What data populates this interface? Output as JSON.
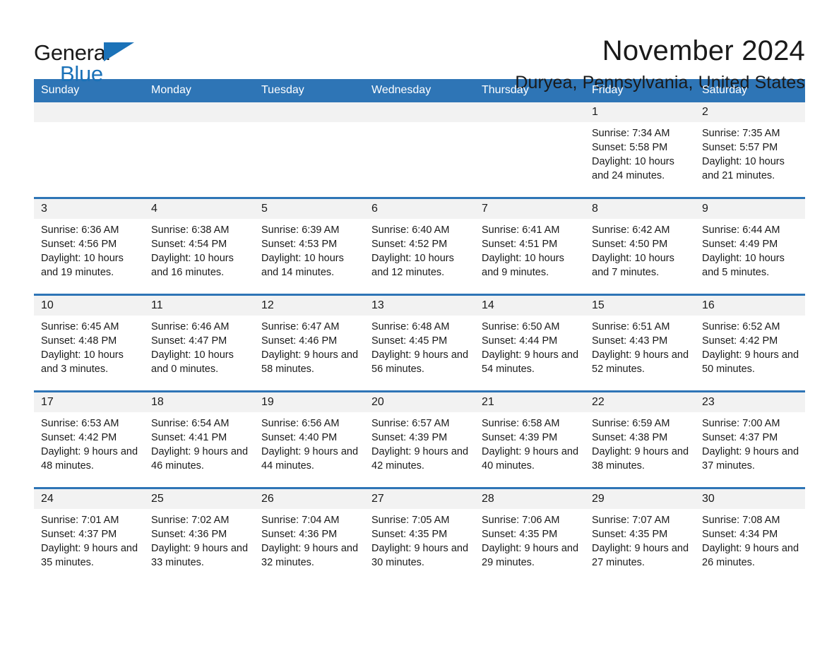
{
  "brand": {
    "name_part1": "General",
    "name_part2": "Blue",
    "accent_color": "#1b72b8",
    "flag_icon": "blue-triangle-icon"
  },
  "header": {
    "title": "November 2024",
    "subtitle": "Duryea, Pennsylvania, United States"
  },
  "theme": {
    "header_blue": "#2e75b6",
    "daynum_band": "#f2f2f2",
    "page_background": "#ffffff",
    "text": "#1a1a1a"
  },
  "calendar": {
    "weekday_headers": [
      "Sunday",
      "Monday",
      "Tuesday",
      "Wednesday",
      "Thursday",
      "Friday",
      "Saturday"
    ],
    "labels": {
      "sunrise": "Sunrise:",
      "sunset": "Sunset:",
      "daylight": "Daylight:"
    },
    "weeks": [
      [
        {
          "day": "",
          "sunrise": "",
          "sunset": "",
          "daylight": ""
        },
        {
          "day": "",
          "sunrise": "",
          "sunset": "",
          "daylight": ""
        },
        {
          "day": "",
          "sunrise": "",
          "sunset": "",
          "daylight": ""
        },
        {
          "day": "",
          "sunrise": "",
          "sunset": "",
          "daylight": ""
        },
        {
          "day": "",
          "sunrise": "",
          "sunset": "",
          "daylight": ""
        },
        {
          "day": "1",
          "sunrise": "Sunrise: 7:34 AM",
          "sunset": "Sunset: 5:58 PM",
          "daylight": "Daylight: 10 hours and 24 minutes."
        },
        {
          "day": "2",
          "sunrise": "Sunrise: 7:35 AM",
          "sunset": "Sunset: 5:57 PM",
          "daylight": "Daylight: 10 hours and 21 minutes."
        }
      ],
      [
        {
          "day": "3",
          "sunrise": "Sunrise: 6:36 AM",
          "sunset": "Sunset: 4:56 PM",
          "daylight": "Daylight: 10 hours and 19 minutes."
        },
        {
          "day": "4",
          "sunrise": "Sunrise: 6:38 AM",
          "sunset": "Sunset: 4:54 PM",
          "daylight": "Daylight: 10 hours and 16 minutes."
        },
        {
          "day": "5",
          "sunrise": "Sunrise: 6:39 AM",
          "sunset": "Sunset: 4:53 PM",
          "daylight": "Daylight: 10 hours and 14 minutes."
        },
        {
          "day": "6",
          "sunrise": "Sunrise: 6:40 AM",
          "sunset": "Sunset: 4:52 PM",
          "daylight": "Daylight: 10 hours and 12 minutes."
        },
        {
          "day": "7",
          "sunrise": "Sunrise: 6:41 AM",
          "sunset": "Sunset: 4:51 PM",
          "daylight": "Daylight: 10 hours and 9 minutes."
        },
        {
          "day": "8",
          "sunrise": "Sunrise: 6:42 AM",
          "sunset": "Sunset: 4:50 PM",
          "daylight": "Daylight: 10 hours and 7 minutes."
        },
        {
          "day": "9",
          "sunrise": "Sunrise: 6:44 AM",
          "sunset": "Sunset: 4:49 PM",
          "daylight": "Daylight: 10 hours and 5 minutes."
        }
      ],
      [
        {
          "day": "10",
          "sunrise": "Sunrise: 6:45 AM",
          "sunset": "Sunset: 4:48 PM",
          "daylight": "Daylight: 10 hours and 3 minutes."
        },
        {
          "day": "11",
          "sunrise": "Sunrise: 6:46 AM",
          "sunset": "Sunset: 4:47 PM",
          "daylight": "Daylight: 10 hours and 0 minutes."
        },
        {
          "day": "12",
          "sunrise": "Sunrise: 6:47 AM",
          "sunset": "Sunset: 4:46 PM",
          "daylight": "Daylight: 9 hours and 58 minutes."
        },
        {
          "day": "13",
          "sunrise": "Sunrise: 6:48 AM",
          "sunset": "Sunset: 4:45 PM",
          "daylight": "Daylight: 9 hours and 56 minutes."
        },
        {
          "day": "14",
          "sunrise": "Sunrise: 6:50 AM",
          "sunset": "Sunset: 4:44 PM",
          "daylight": "Daylight: 9 hours and 54 minutes."
        },
        {
          "day": "15",
          "sunrise": "Sunrise: 6:51 AM",
          "sunset": "Sunset: 4:43 PM",
          "daylight": "Daylight: 9 hours and 52 minutes."
        },
        {
          "day": "16",
          "sunrise": "Sunrise: 6:52 AM",
          "sunset": "Sunset: 4:42 PM",
          "daylight": "Daylight: 9 hours and 50 minutes."
        }
      ],
      [
        {
          "day": "17",
          "sunrise": "Sunrise: 6:53 AM",
          "sunset": "Sunset: 4:42 PM",
          "daylight": "Daylight: 9 hours and 48 minutes."
        },
        {
          "day": "18",
          "sunrise": "Sunrise: 6:54 AM",
          "sunset": "Sunset: 4:41 PM",
          "daylight": "Daylight: 9 hours and 46 minutes."
        },
        {
          "day": "19",
          "sunrise": "Sunrise: 6:56 AM",
          "sunset": "Sunset: 4:40 PM",
          "daylight": "Daylight: 9 hours and 44 minutes."
        },
        {
          "day": "20",
          "sunrise": "Sunrise: 6:57 AM",
          "sunset": "Sunset: 4:39 PM",
          "daylight": "Daylight: 9 hours and 42 minutes."
        },
        {
          "day": "21",
          "sunrise": "Sunrise: 6:58 AM",
          "sunset": "Sunset: 4:39 PM",
          "daylight": "Daylight: 9 hours and 40 minutes."
        },
        {
          "day": "22",
          "sunrise": "Sunrise: 6:59 AM",
          "sunset": "Sunset: 4:38 PM",
          "daylight": "Daylight: 9 hours and 38 minutes."
        },
        {
          "day": "23",
          "sunrise": "Sunrise: 7:00 AM",
          "sunset": "Sunset: 4:37 PM",
          "daylight": "Daylight: 9 hours and 37 minutes."
        }
      ],
      [
        {
          "day": "24",
          "sunrise": "Sunrise: 7:01 AM",
          "sunset": "Sunset: 4:37 PM",
          "daylight": "Daylight: 9 hours and 35 minutes."
        },
        {
          "day": "25",
          "sunrise": "Sunrise: 7:02 AM",
          "sunset": "Sunset: 4:36 PM",
          "daylight": "Daylight: 9 hours and 33 minutes."
        },
        {
          "day": "26",
          "sunrise": "Sunrise: 7:04 AM",
          "sunset": "Sunset: 4:36 PM",
          "daylight": "Daylight: 9 hours and 32 minutes."
        },
        {
          "day": "27",
          "sunrise": "Sunrise: 7:05 AM",
          "sunset": "Sunset: 4:35 PM",
          "daylight": "Daylight: 9 hours and 30 minutes."
        },
        {
          "day": "28",
          "sunrise": "Sunrise: 7:06 AM",
          "sunset": "Sunset: 4:35 PM",
          "daylight": "Daylight: 9 hours and 29 minutes."
        },
        {
          "day": "29",
          "sunrise": "Sunrise: 7:07 AM",
          "sunset": "Sunset: 4:35 PM",
          "daylight": "Daylight: 9 hours and 27 minutes."
        },
        {
          "day": "30",
          "sunrise": "Sunrise: 7:08 AM",
          "sunset": "Sunset: 4:34 PM",
          "daylight": "Daylight: 9 hours and 26 minutes."
        }
      ]
    ]
  }
}
